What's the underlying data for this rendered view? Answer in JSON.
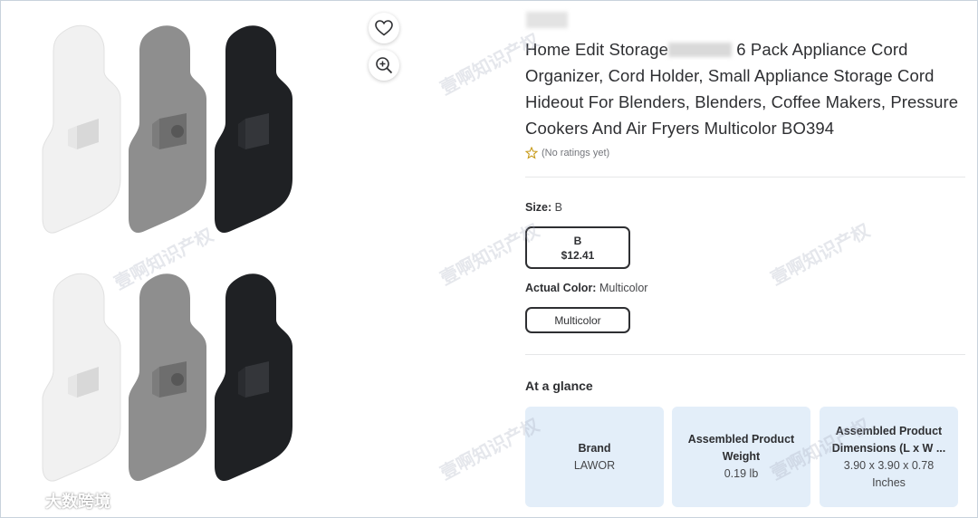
{
  "product": {
    "title_part1": "Home Edit Storage",
    "title_part2": " 6 Pack Appliance Cord Organizer, Cord Holder, Small Appliance Storage Cord Hideout For Blenders, Blenders, Coffee Makers, Pressure Cookers And Air Fryers Multicolor BO394",
    "rating_text": "(No ratings yet)"
  },
  "size": {
    "label": "Size:",
    "value": "B",
    "option": {
      "name": "B",
      "price": "$12.41"
    }
  },
  "color": {
    "label": "Actual Color:",
    "value": "Multicolor",
    "option": "Multicolor"
  },
  "glance": {
    "heading": "At a glance",
    "cards": [
      {
        "key": "Brand",
        "value": "LAWOR"
      },
      {
        "key": "Assembled Product Weight",
        "value": "0.19 lb"
      },
      {
        "key": "Assembled Product Dimensions (L x W ...",
        "value": "3.90 x 3.90 x 0.78 Inches"
      }
    ]
  },
  "watermark": {
    "text": "壹啊知识产权",
    "corner": "大数跨境"
  },
  "icons": {
    "favorite": "heart-icon",
    "zoom": "zoom-in-icon",
    "rating": "star-outline-icon"
  },
  "colors": {
    "clip_white": "#f1f1f1",
    "clip_gray": "#8e8e8e",
    "clip_black": "#1f2124",
    "accent_card": "#e3eef9",
    "star": "#c79a18"
  }
}
